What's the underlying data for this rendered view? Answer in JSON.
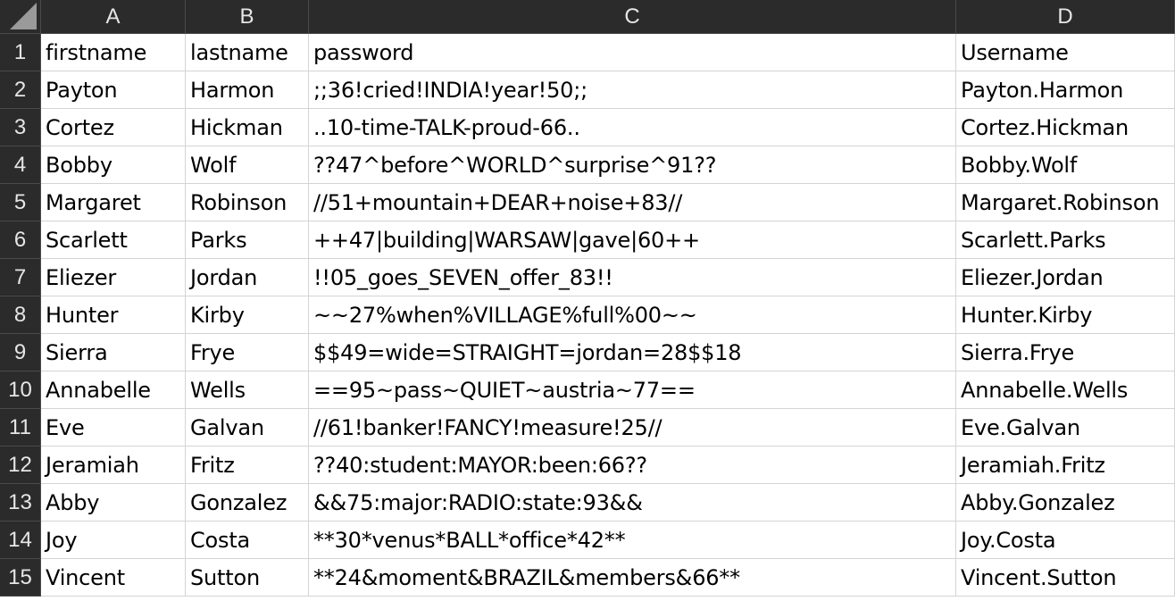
{
  "columns": [
    "A",
    "B",
    "C",
    "D"
  ],
  "rows": [
    "1",
    "2",
    "3",
    "4",
    "5",
    "6",
    "7",
    "8",
    "9",
    "10",
    "11",
    "12",
    "13",
    "14",
    "15"
  ],
  "table": [
    [
      "firstname",
      "lastname",
      "password",
      "Username"
    ],
    [
      "Payton",
      "Harmon",
      ";;36!cried!INDIA!year!50;;",
      "Payton.Harmon"
    ],
    [
      "Cortez",
      "Hickman",
      "..10-time-TALK-proud-66..",
      "Cortez.Hickman"
    ],
    [
      "Bobby",
      "Wolf",
      "??47^before^WORLD^surprise^91??",
      "Bobby.Wolf"
    ],
    [
      "Margaret",
      "Robinson",
      "//51+mountain+DEAR+noise+83//",
      "Margaret.Robinson"
    ],
    [
      "Scarlett",
      "Parks",
      "++47|building|WARSAW|gave|60++",
      "Scarlett.Parks"
    ],
    [
      "Eliezer",
      "Jordan",
      "!!05_goes_SEVEN_offer_83!!",
      "Eliezer.Jordan"
    ],
    [
      "Hunter",
      "Kirby",
      "~~27%when%VILLAGE%full%00~~",
      "Hunter.Kirby"
    ],
    [
      "Sierra",
      "Frye",
      "$$49=wide=STRAIGHT=jordan=28$$18",
      "Sierra.Frye"
    ],
    [
      "Annabelle",
      "Wells",
      "==95~pass~QUIET~austria~77==",
      "Annabelle.Wells"
    ],
    [
      "Eve",
      "Galvan",
      "//61!banker!FANCY!measure!25//",
      "Eve.Galvan"
    ],
    [
      "Jeramiah",
      "Fritz",
      "??40:student:MAYOR:been:66??",
      "Jeramiah.Fritz"
    ],
    [
      "Abby",
      "Gonzalez",
      "&&75:major:RADIO:state:93&&",
      "Abby.Gonzalez"
    ],
    [
      "Joy",
      "Costa",
      "**30*venus*BALL*office*42**",
      "Joy.Costa"
    ],
    [
      "Vincent",
      "Sutton",
      "**24&moment&BRAZIL&members&66**",
      "Vincent.Sutton"
    ]
  ],
  "colors": {
    "header_bg": "#2b2b2b",
    "header_text": "#e6e6e6",
    "cell_bg": "#ffffff",
    "gridline": "#d4d4d4"
  }
}
